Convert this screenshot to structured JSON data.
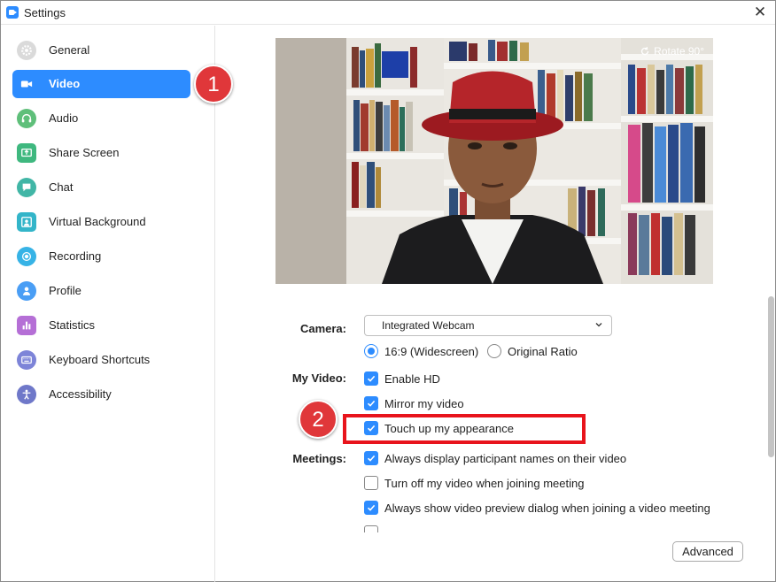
{
  "window": {
    "title": "Settings"
  },
  "sidebar": {
    "items": [
      {
        "label": "General",
        "icon": "gear-icon",
        "color": "#9a9a9a"
      },
      {
        "label": "Video",
        "icon": "video-camera-icon",
        "color": "#2d8cff",
        "active": true
      },
      {
        "label": "Audio",
        "icon": "headphones-icon",
        "color": "#5fbf7a"
      },
      {
        "label": "Share Screen",
        "icon": "share-screen-icon",
        "color": "#3fb87f"
      },
      {
        "label": "Chat",
        "icon": "chat-bubble-icon",
        "color": "#41b6a6"
      },
      {
        "label": "Virtual Background",
        "icon": "virtual-background-icon",
        "color": "#33b5c9"
      },
      {
        "label": "Recording",
        "icon": "recording-icon",
        "color": "#37b3e6"
      },
      {
        "label": "Profile",
        "icon": "profile-icon",
        "color": "#4a9ef5"
      },
      {
        "label": "Statistics",
        "icon": "statistics-icon",
        "color": "#b56fd6"
      },
      {
        "label": "Keyboard Shortcuts",
        "icon": "keyboard-icon",
        "color": "#7d84d8"
      },
      {
        "label": "Accessibility",
        "icon": "accessibility-icon",
        "color": "#6f78c9"
      }
    ]
  },
  "annotations": {
    "badge_1": "1",
    "badge_2": "2",
    "highlight_color": "#e8141c"
  },
  "preview": {
    "rotate_label": "Rotate 90°"
  },
  "camera": {
    "label": "Camera:",
    "selected": "Integrated Webcam",
    "ratio_widescreen": "16:9 (Widescreen)",
    "ratio_original": "Original Ratio",
    "widescreen_selected": true
  },
  "my_video": {
    "label": "My Video:",
    "options": [
      {
        "label": "Enable HD",
        "checked": true
      },
      {
        "label": "Mirror my video",
        "checked": true
      },
      {
        "label": "Touch up my appearance",
        "checked": true
      }
    ]
  },
  "meetings": {
    "label": "Meetings:",
    "options": [
      {
        "label": "Always display participant names on their video",
        "checked": true
      },
      {
        "label": "Turn off my video when joining meeting",
        "checked": false
      },
      {
        "label": "Always show video preview dialog when joining a video meeting",
        "checked": true
      }
    ]
  },
  "advanced_label": "Advanced",
  "colors": {
    "accent": "#2d8cff",
    "sidebar_active_text": "#ffffff"
  }
}
